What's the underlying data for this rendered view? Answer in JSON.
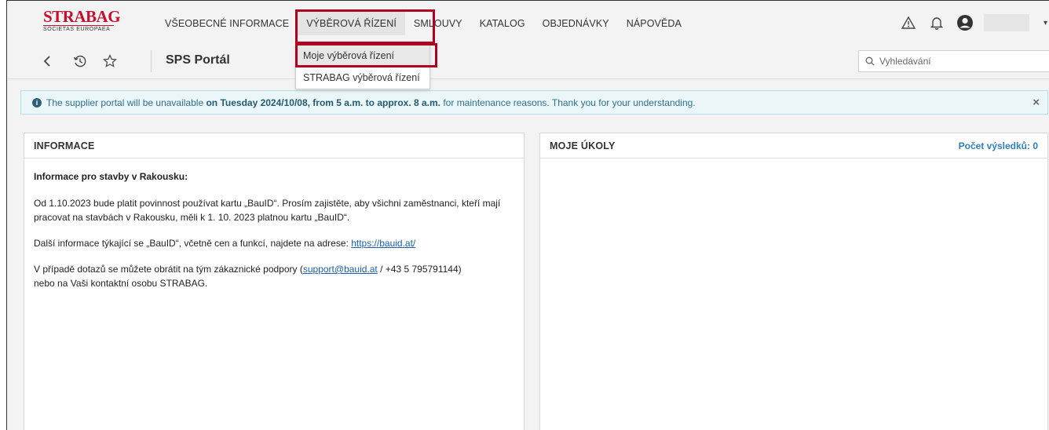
{
  "brand": {
    "name": "STRABAG",
    "subtitle": "SOCIETAS EUROPAEA",
    "color": "#c8102e"
  },
  "nav": {
    "items": [
      {
        "label": "VŠEOBECNÉ INFORMACE"
      },
      {
        "label": "VÝBĚROVÁ ŘÍZENÍ"
      },
      {
        "label": "SMLOUVY"
      },
      {
        "label": "KATALOG"
      },
      {
        "label": "OBJEDNÁVKY"
      },
      {
        "label": "NÁPOVĚDA"
      }
    ],
    "active_index": 1
  },
  "dropdown": {
    "items": [
      {
        "label": "Moje výběrová řízení"
      },
      {
        "label": "STRABAG výběrová řízení"
      }
    ]
  },
  "header": {
    "page_title": "SPS Portál",
    "search_placeholder": "Vyhledávání"
  },
  "alert": {
    "prefix": "The supplier portal will be unavailable ",
    "bold": "on Tuesday 2024/10/08, from 5 a.m. to approx. 8 a.m.",
    "suffix": " for maintenance reasons. Thank you for your understanding.",
    "close": "×"
  },
  "info_panel": {
    "title": "INFORMACE",
    "heading": "Informace pro stavby v Rakousku:",
    "p1": "Od 1.10.2023 bude platit povinnost používat kartu „BauID“. Prosím zajistěte, aby všichni zaměstnanci, kteří mají pracovat na stavbách v Rakousku, měli k 1. 10. 2023 platnou kartu „BauID“.",
    "p2_text": "Další informace týkající se  „BauID“, včetně cen a funkcí, najdete na adrese: ",
    "p2_link": "https://bauid.at/",
    "p3_text": "V případě dotazů se můžete obrátit na tým zákaznické podpory (",
    "p3_link": "support@bauid.at",
    "p3_rest": " / +43 5 795791144)",
    "p3_line2": "nebo na Vaši kontaktní osobu STRABAG."
  },
  "tasks_panel": {
    "title": "MOJE ÚKOLY",
    "results": "Počet výsledků: 0"
  },
  "colors": {
    "highlight": "#b00020",
    "link": "#1a5fb4",
    "alert_bg": "#eaf6f8"
  }
}
